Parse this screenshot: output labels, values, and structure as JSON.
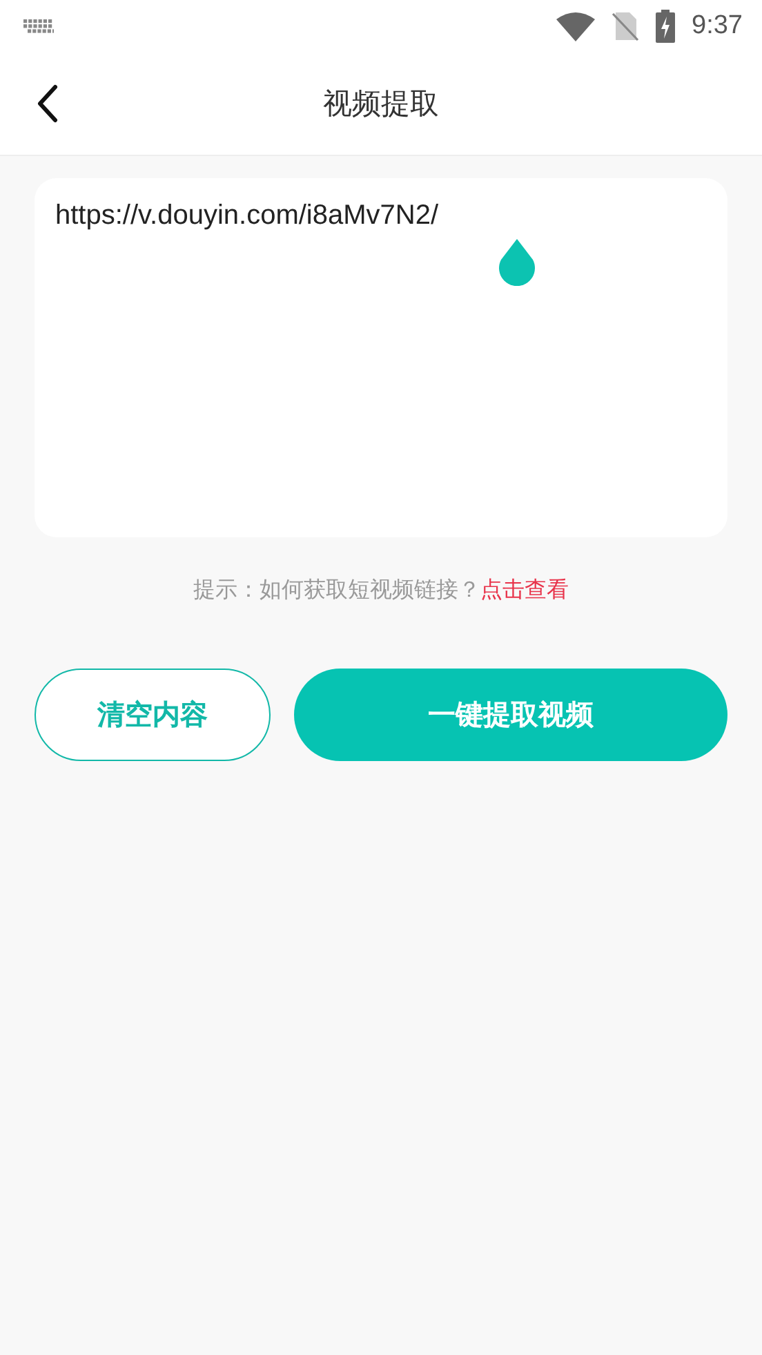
{
  "status_bar": {
    "time": "9:37"
  },
  "header": {
    "title": "视频提取"
  },
  "link_input": {
    "value": "https://v.douyin.com/i8aMv7N2/"
  },
  "hint": {
    "text": "提示：如何获取短视频链接？",
    "link": "点击查看"
  },
  "buttons": [
    {
      "kind": "outline",
      "label": "清空内容"
    },
    {
      "kind": "filled",
      "label": "一键提取视频"
    }
  ]
}
